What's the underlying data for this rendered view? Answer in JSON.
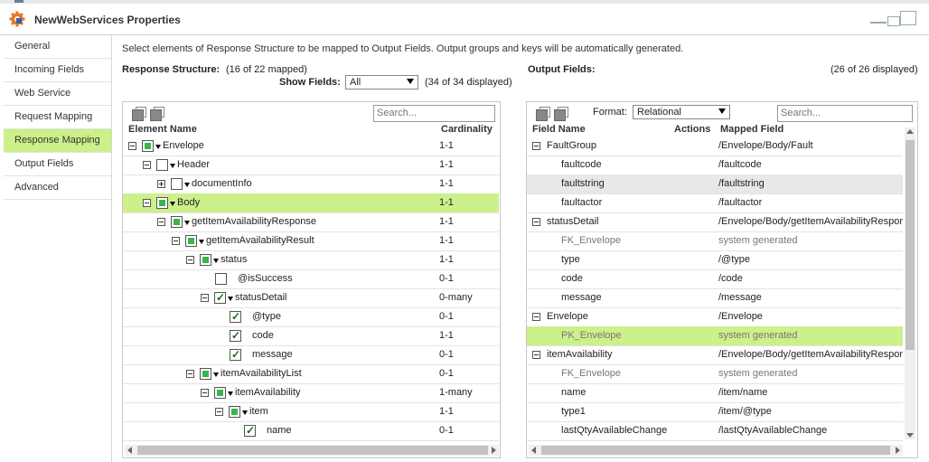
{
  "window": {
    "title": "NewWebServices Properties"
  },
  "sidebar": {
    "items": [
      {
        "label": "General"
      },
      {
        "label": "Incoming Fields"
      },
      {
        "label": "Web Service"
      },
      {
        "label": "Request Mapping"
      },
      {
        "label": "Response Mapping",
        "active": true
      },
      {
        "label": "Output Fields"
      },
      {
        "label": "Advanced"
      }
    ]
  },
  "description": "Select elements of Response Structure to be mapped to Output Fields. Output groups and keys will be automatically generated.",
  "left": {
    "heading": "Response Structure:",
    "mapped": "(16 of 22 mapped)",
    "show_fields_label": "Show Fields:",
    "show_fields_value": "All",
    "displayed": "(34 of 34 displayed)",
    "search_placeholder": "Search...",
    "col_element": "Element Name",
    "col_cardinality": "Cardinality",
    "rows": [
      {
        "name": "Envelope",
        "card": "1-1",
        "indent": 0,
        "exp": "minus",
        "cb": "partial",
        "dd": true
      },
      {
        "name": "Header",
        "card": "1-1",
        "indent": 1,
        "exp": "minus",
        "cb": "empty",
        "dd": true
      },
      {
        "name": "documentInfo",
        "card": "1-1",
        "indent": 2,
        "exp": "plus",
        "cb": "empty",
        "dd": true
      },
      {
        "name": "Body",
        "card": "1-1",
        "indent": 1,
        "exp": "minus",
        "cb": "partial",
        "dd": true,
        "hl": true
      },
      {
        "name": "getItemAvailabilityResponse",
        "card": "1-1",
        "indent": 2,
        "exp": "minus",
        "cb": "partial",
        "dd": true
      },
      {
        "name": "getItemAvailabilityResult",
        "card": "1-1",
        "indent": 3,
        "exp": "minus",
        "cb": "partial",
        "dd": true
      },
      {
        "name": "status",
        "card": "1-1",
        "indent": 4,
        "exp": "minus",
        "cb": "partial",
        "dd": true
      },
      {
        "name": "@isSuccess",
        "card": "0-1",
        "indent": 5,
        "exp": "none",
        "cb": "empty",
        "dd": false
      },
      {
        "name": "statusDetail",
        "card": "0-many",
        "indent": 5,
        "exp": "minus",
        "cb": "checked",
        "dd": true
      },
      {
        "name": "@type",
        "card": "0-1",
        "indent": 6,
        "exp": "none",
        "cb": "checked",
        "dd": false
      },
      {
        "name": "code",
        "card": "1-1",
        "indent": 6,
        "exp": "none",
        "cb": "checked",
        "dd": false
      },
      {
        "name": "message",
        "card": "0-1",
        "indent": 6,
        "exp": "none",
        "cb": "checked",
        "dd": false
      },
      {
        "name": "itemAvailabilityList",
        "card": "0-1",
        "indent": 4,
        "exp": "minus",
        "cb": "partial",
        "dd": true
      },
      {
        "name": "itemAvailability",
        "card": "1-many",
        "indent": 5,
        "exp": "minus",
        "cb": "partial",
        "dd": true
      },
      {
        "name": "item",
        "card": "1-1",
        "indent": 6,
        "exp": "minus",
        "cb": "partial",
        "dd": true
      },
      {
        "name": "name",
        "card": "0-1",
        "indent": 7,
        "exp": "none",
        "cb": "checked",
        "dd": false
      }
    ]
  },
  "right": {
    "heading": "Output Fields:",
    "displayed": "(26 of 26 displayed)",
    "format_label": "Format:",
    "format_value": "Relational",
    "search_placeholder": "Search...",
    "col_field": "Field Name",
    "col_actions": "Actions",
    "col_mapped": "Mapped Field",
    "rows": [
      {
        "name": "FaultGroup",
        "mapped": "/Envelope/Body/Fault",
        "group": true
      },
      {
        "name": "faultcode",
        "mapped": "/faultcode"
      },
      {
        "name": "faultstring",
        "mapped": "/faultstring",
        "gray": true
      },
      {
        "name": "faultactor",
        "mapped": "/faultactor"
      },
      {
        "name": "statusDetail",
        "mapped": "/Envelope/Body/getItemAvailabilityRespons",
        "group": true
      },
      {
        "name": "FK_Envelope",
        "mapped": "system generated",
        "sys": true
      },
      {
        "name": "type",
        "mapped": "/@type"
      },
      {
        "name": "code",
        "mapped": "/code"
      },
      {
        "name": "message",
        "mapped": "/message"
      },
      {
        "name": "Envelope",
        "mapped": "/Envelope",
        "group": true
      },
      {
        "name": "PK_Envelope",
        "mapped": "system generated",
        "sys": true,
        "hl": true
      },
      {
        "name": "itemAvailability",
        "mapped": "/Envelope/Body/getItemAvailabilityRespons",
        "group": true
      },
      {
        "name": "FK_Envelope",
        "mapped": "system generated",
        "sys": true
      },
      {
        "name": "name",
        "mapped": "/item/name"
      },
      {
        "name": "type1",
        "mapped": "/item/@type"
      },
      {
        "name": "lastQtyAvailableChange",
        "mapped": "/lastQtyAvailableChange"
      }
    ]
  },
  "colors": {
    "accent": "#ccf08a",
    "check": "#3bb54a"
  }
}
